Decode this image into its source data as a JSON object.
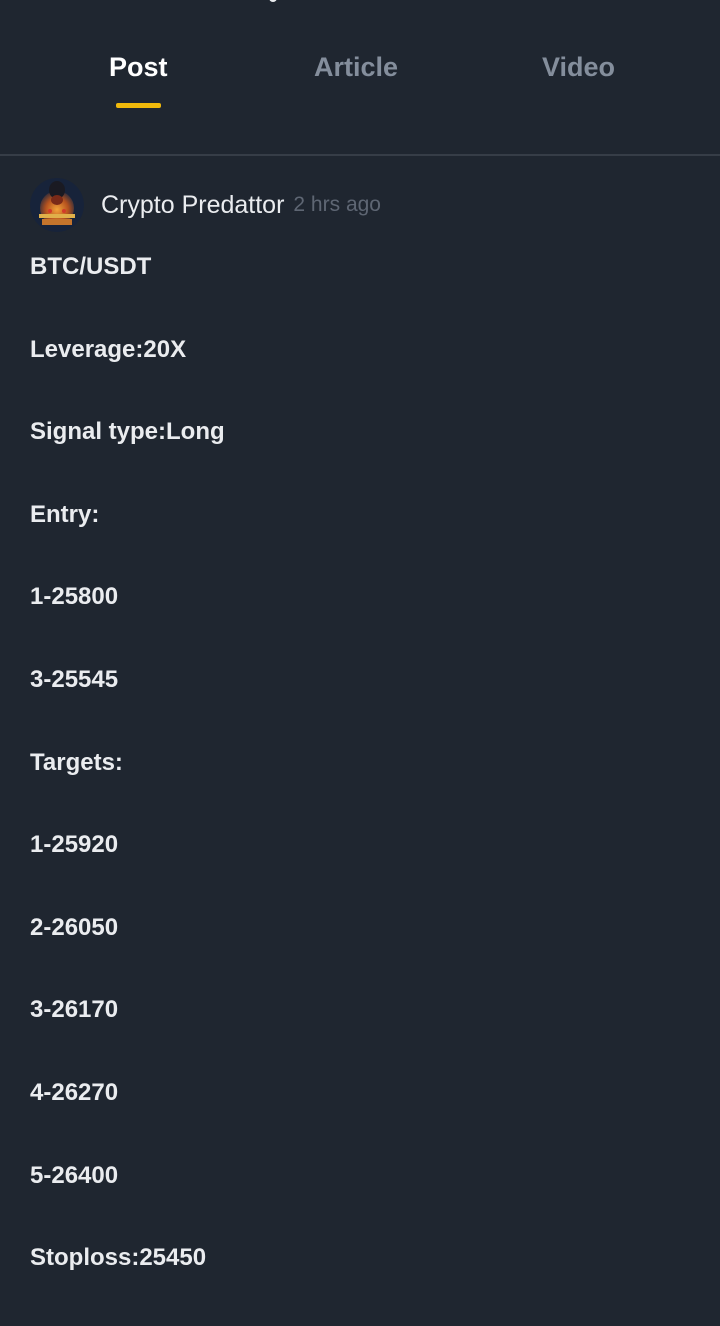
{
  "tabs": [
    {
      "label": "Post",
      "active": true
    },
    {
      "label": "Article",
      "active": false
    },
    {
      "label": "Video",
      "active": false
    }
  ],
  "colors": {
    "background": "#1f2630",
    "active_underline": "#f0b90b",
    "inactive_tab": "#848e9c",
    "timestamp": "#5e6673"
  },
  "post": {
    "author": "Crypto Predattor",
    "time": "2 hrs ago",
    "avatar_icon": "avatar-image",
    "lines": [
      "BTC/USDT",
      "Leverage:20X",
      "Signal type:Long",
      "Entry:",
      "1-25800",
      "3-25545",
      "Targets:",
      "1-25920",
      "2-26050",
      "3-26170",
      "4-26270",
      "5-26400",
      "Stoploss:25450"
    ]
  }
}
